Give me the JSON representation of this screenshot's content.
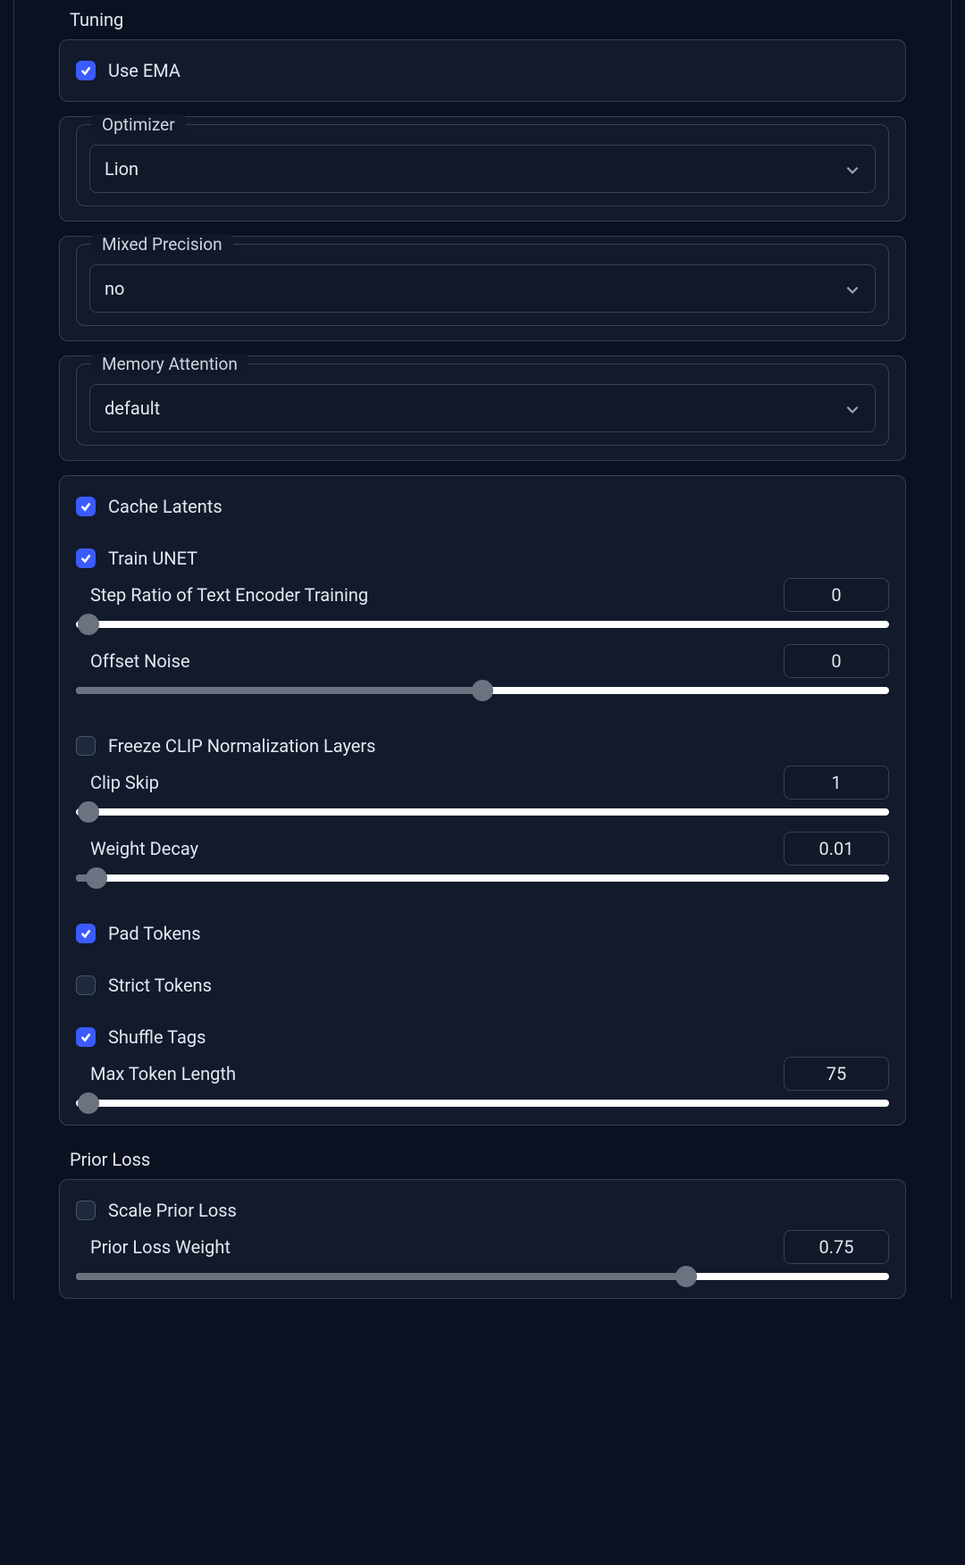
{
  "tuning": {
    "title": "Tuning",
    "use_ema": {
      "label": "Use EMA",
      "checked": true
    },
    "optimizer": {
      "legend": "Optimizer",
      "value": "Lion"
    },
    "mixed_precision": {
      "legend": "Mixed Precision",
      "value": "no"
    },
    "memory_attention": {
      "legend": "Memory Attention",
      "value": "default"
    }
  },
  "advanced": {
    "cache_latents": {
      "label": "Cache Latents",
      "checked": true
    },
    "train_unet": {
      "label": "Train UNET",
      "checked": true
    },
    "step_ratio": {
      "label": "Step Ratio of Text Encoder Training",
      "value": "0",
      "percent": 0
    },
    "offset_noise": {
      "label": "Offset Noise",
      "value": "0",
      "percent": 50
    },
    "freeze_clip": {
      "label": "Freeze CLIP Normalization Layers",
      "checked": false
    },
    "clip_skip": {
      "label": "Clip Skip",
      "value": "1",
      "percent": 0
    },
    "weight_decay": {
      "label": "Weight Decay",
      "value": "0.01",
      "percent": 2
    },
    "pad_tokens": {
      "label": "Pad Tokens",
      "checked": true
    },
    "strict_tokens": {
      "label": "Strict Tokens",
      "checked": false
    },
    "shuffle_tags": {
      "label": "Shuffle Tags",
      "checked": true
    },
    "max_token_length": {
      "label": "Max Token Length",
      "value": "75",
      "percent": 0
    }
  },
  "prior_loss": {
    "title": "Prior Loss",
    "scale_prior_loss": {
      "label": "Scale Prior Loss",
      "checked": false
    },
    "prior_loss_weight": {
      "label": "Prior Loss Weight",
      "value": "0.75",
      "percent": 75
    }
  }
}
